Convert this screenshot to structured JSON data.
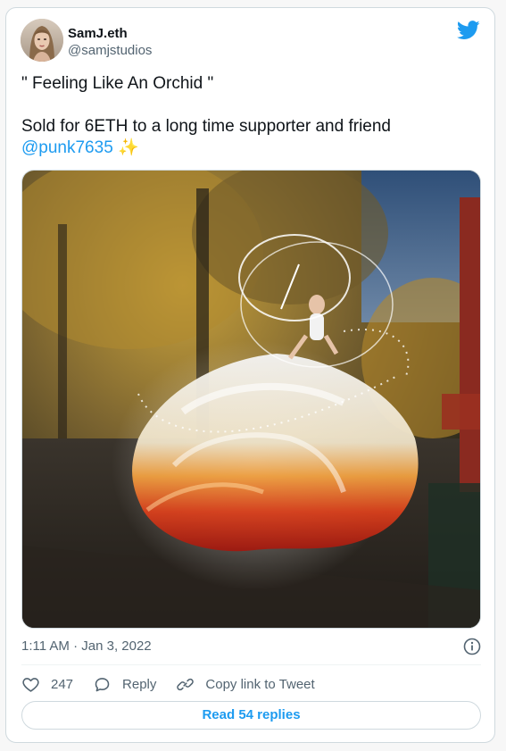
{
  "author": {
    "display_name": "SamJ.eth",
    "handle": "@samjstudios"
  },
  "tweet": {
    "title_line": "\" Feeling Like An Orchid \"",
    "body_line": "Sold for 6ETH to a long time supporter and friend",
    "mention": "@punk7635",
    "emoji": "✨"
  },
  "meta": {
    "timestamp": "1:11 AM · Jan 3, 2022"
  },
  "actions": {
    "likes_count": "247",
    "reply_label": "Reply",
    "copy_link_label": "Copy link to Tweet"
  },
  "replies_button": {
    "label": "Read 54 replies"
  },
  "colors": {
    "brand_blue": "#1d9bf0",
    "secondary_text": "#536471",
    "border": "#cfd9de"
  },
  "icons": {
    "brand": "twitter-bird-icon",
    "info": "info-icon",
    "like": "heart-icon",
    "reply": "speech-bubble-icon",
    "copy": "link-icon"
  }
}
